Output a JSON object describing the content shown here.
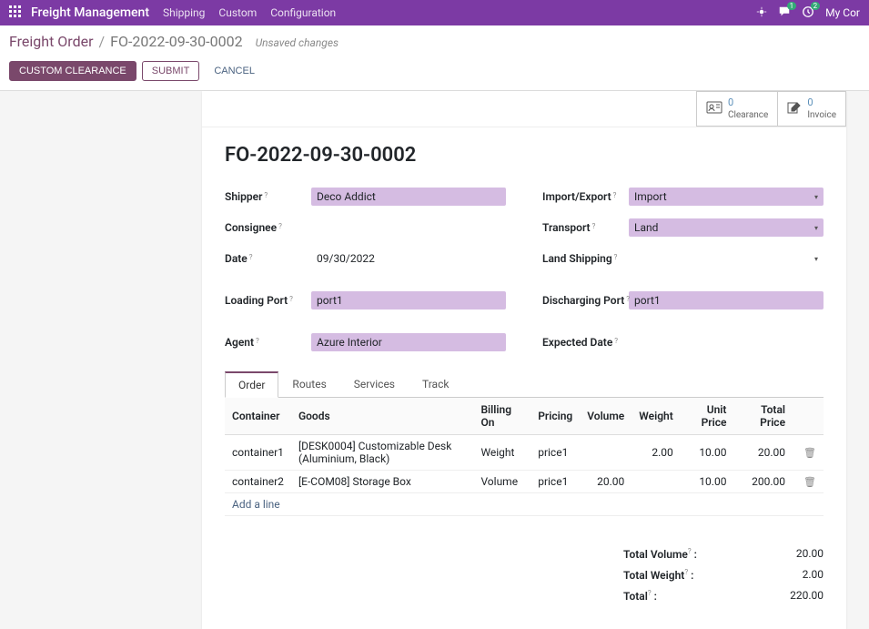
{
  "topbar": {
    "brand": "Freight Management",
    "menu": [
      "Shipping",
      "Custom",
      "Configuration"
    ],
    "chat_badge": "1",
    "activity_badge": "2",
    "company": "My Cor"
  },
  "breadcrumb": {
    "parent": "Freight Order",
    "current": "FO-2022-09-30-0002",
    "status": "Unsaved changes"
  },
  "actions": {
    "custom_clearance": "CUSTOM CLEARANCE",
    "submit": "SUBMIT",
    "cancel": "CANCEL"
  },
  "stats": {
    "clearance": {
      "count": "0",
      "label": "Clearance"
    },
    "invoice": {
      "count": "0",
      "label": "Invoice"
    }
  },
  "form": {
    "title": "FO-2022-09-30-0002",
    "left": {
      "shipper": {
        "label": "Shipper",
        "value": "Deco Addict"
      },
      "consignee": {
        "label": "Consignee",
        "value": ""
      },
      "date": {
        "label": "Date",
        "value": "09/30/2022"
      },
      "loading_port": {
        "label": "Loading Port",
        "value": "port1"
      },
      "agent": {
        "label": "Agent",
        "value": "Azure Interior"
      }
    },
    "right": {
      "import_export": {
        "label": "Import/Export",
        "value": "Import"
      },
      "transport": {
        "label": "Transport",
        "value": "Land"
      },
      "land_shipping": {
        "label": "Land Shipping",
        "value": ""
      },
      "discharging_port": {
        "label": "Discharging Port",
        "value": "port1"
      },
      "expected_date": {
        "label": "Expected Date",
        "value": ""
      }
    }
  },
  "tabs": [
    "Order",
    "Routes",
    "Services",
    "Track"
  ],
  "table": {
    "headers": {
      "container": "Container",
      "goods": "Goods",
      "billing_on": "Billing On",
      "pricing": "Pricing",
      "volume": "Volume",
      "weight": "Weight",
      "unit_price": "Unit Price",
      "total_price": "Total Price"
    },
    "rows": [
      {
        "container": "container1",
        "goods": "[DESK0004] Customizable Desk (Aluminium, Black)",
        "billing_on": "Weight",
        "pricing": "price1",
        "volume": "",
        "weight": "2.00",
        "unit_price": "10.00",
        "total_price": "20.00"
      },
      {
        "container": "container2",
        "goods": "[E-COM08] Storage Box",
        "billing_on": "Volume",
        "pricing": "price1",
        "volume": "20.00",
        "weight": "",
        "unit_price": "10.00",
        "total_price": "200.00"
      }
    ],
    "add_line": "Add a line"
  },
  "totals": {
    "total_volume": {
      "label": "Total Volume",
      "value": "20.00"
    },
    "total_weight": {
      "label": "Total Weight",
      "value": "2.00"
    },
    "total": {
      "label": "Total",
      "value": "220.00"
    }
  }
}
